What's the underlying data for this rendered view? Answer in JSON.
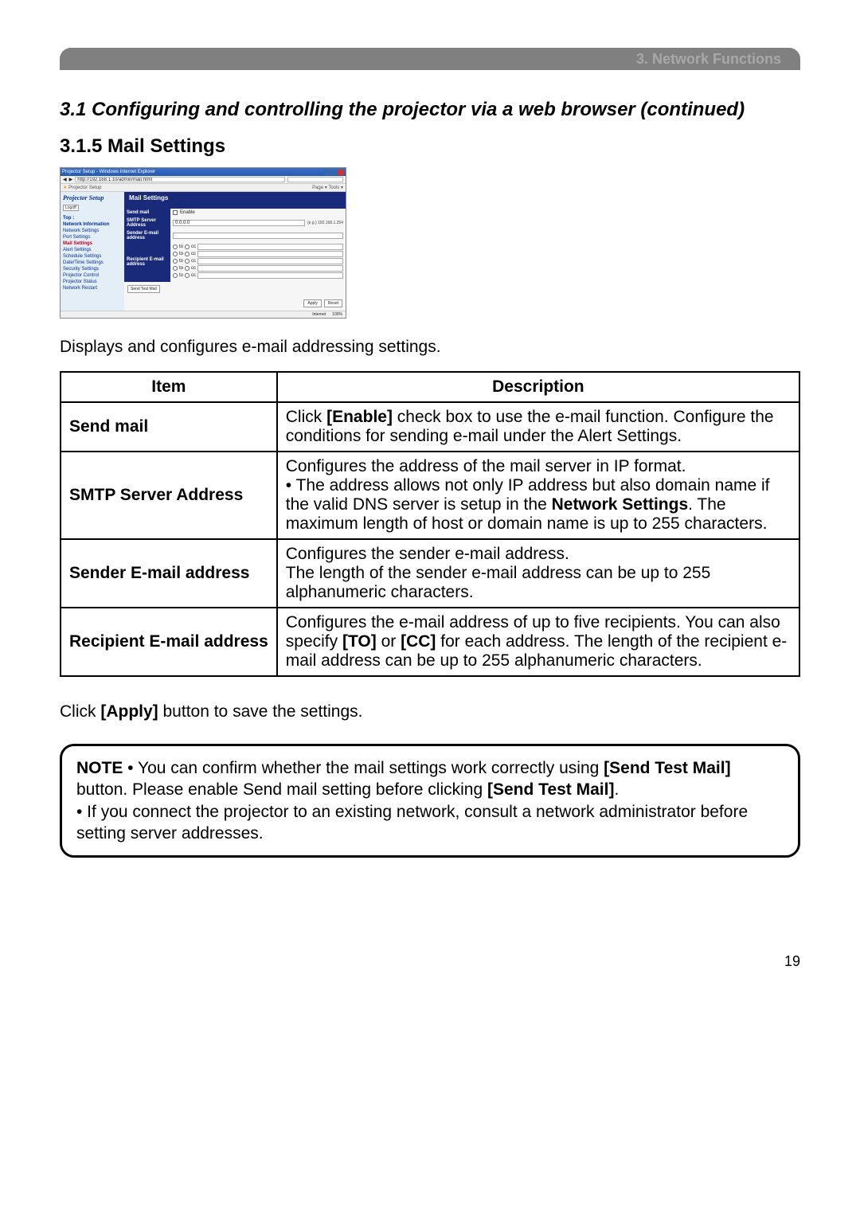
{
  "header": {
    "chapter": "3. Network Functions"
  },
  "section_title": "3.1 Configuring and controlling the projector via a web browser (continued)",
  "subsection_title": "3.1.5 Mail Settings",
  "screenshot": {
    "window_title": "Projector Setup - Windows Internet Explorer",
    "address": "http://192.168.1.10/admin/mail.html",
    "tab": "Projector Setup",
    "toolbar_right": "Page ▾  Tools ▾",
    "brand": "Projector Setup",
    "logoff": "Logoff",
    "sidebar": [
      {
        "label": "Top :",
        "bold": true
      },
      {
        "label": "Network Information",
        "bold": true
      },
      {
        "label": "Network Settings"
      },
      {
        "label": "Port Settings"
      },
      {
        "label": "Mail Settings",
        "active": true
      },
      {
        "label": "Alert Settings"
      },
      {
        "label": "Schedule Settings"
      },
      {
        "label": "Date/Time Settings"
      },
      {
        "label": "Security Settings"
      },
      {
        "label": "Projector Control"
      },
      {
        "label": "Projector Status"
      },
      {
        "label": "Network Restart"
      }
    ],
    "panel_title": "Mail Settings",
    "rows": {
      "send_mail": "Send mail",
      "enable": "Enable",
      "smtp": "SMTP Server Address",
      "smtp_val": "0.0.0.0",
      "smtp_hint": "(e.g.) 192.168.1.254",
      "sender": "Sender E-mail address",
      "recipient": "Recipient E-mail address",
      "to": "to",
      "cc": "cc"
    },
    "send_test": "Send Test Mail",
    "apply": "Apply",
    "reset": "Reset",
    "status_internet": "Internet",
    "status_zoom": "100%"
  },
  "lead": "Displays and configures e-mail addressing settings.",
  "table": {
    "headers": {
      "item": "Item",
      "description": "Description"
    },
    "rows": [
      {
        "item": "Send mail",
        "desc_pre": "Click ",
        "desc_b1": "[Enable]",
        "desc_post": " check box to use the e-mail function. Configure the conditions for sending e-mail under the Alert Settings."
      },
      {
        "item": "SMTP Server Address",
        "desc_pre": "Configures the address of the mail server in IP format.\n• The address allows not only IP address but also domain name if the valid DNS server is setup in the ",
        "desc_b1": "Network Settings",
        "desc_post": ". The maximum length of host or domain name is up to 255 characters."
      },
      {
        "item": "Sender E-mail address",
        "desc_pre": "Configures the sender e-mail address.\nThe length of the sender e-mail address can be up to 255 alphanumeric characters.",
        "desc_b1": "",
        "desc_post": ""
      },
      {
        "item": "Recipient E-mail address",
        "desc_pre": "Configures the e-mail address of up to five recipients. You can also specify ",
        "desc_b1": "[TO]",
        "desc_mid": " or ",
        "desc_b2": "[CC]",
        "desc_post": " for each address. The length of the recipient e-mail address can be up to 255 alphanumeric characters."
      }
    ]
  },
  "apply_line": {
    "pre": "Click ",
    "b": "[Apply]",
    "post": " button to save the settings."
  },
  "note": {
    "label": "NOTE",
    "p1_pre": " • You can confirm whether the mail settings work correctly using ",
    "p1_b1": "[Send Test Mail]",
    "p1_mid": " button. Please enable Send mail setting before clicking ",
    "p1_b2": "[Send Test Mail]",
    "p1_post": ".",
    "p2": "• If you connect the projector to an existing network, consult a network administrator before setting server addresses."
  },
  "page_number": "19"
}
